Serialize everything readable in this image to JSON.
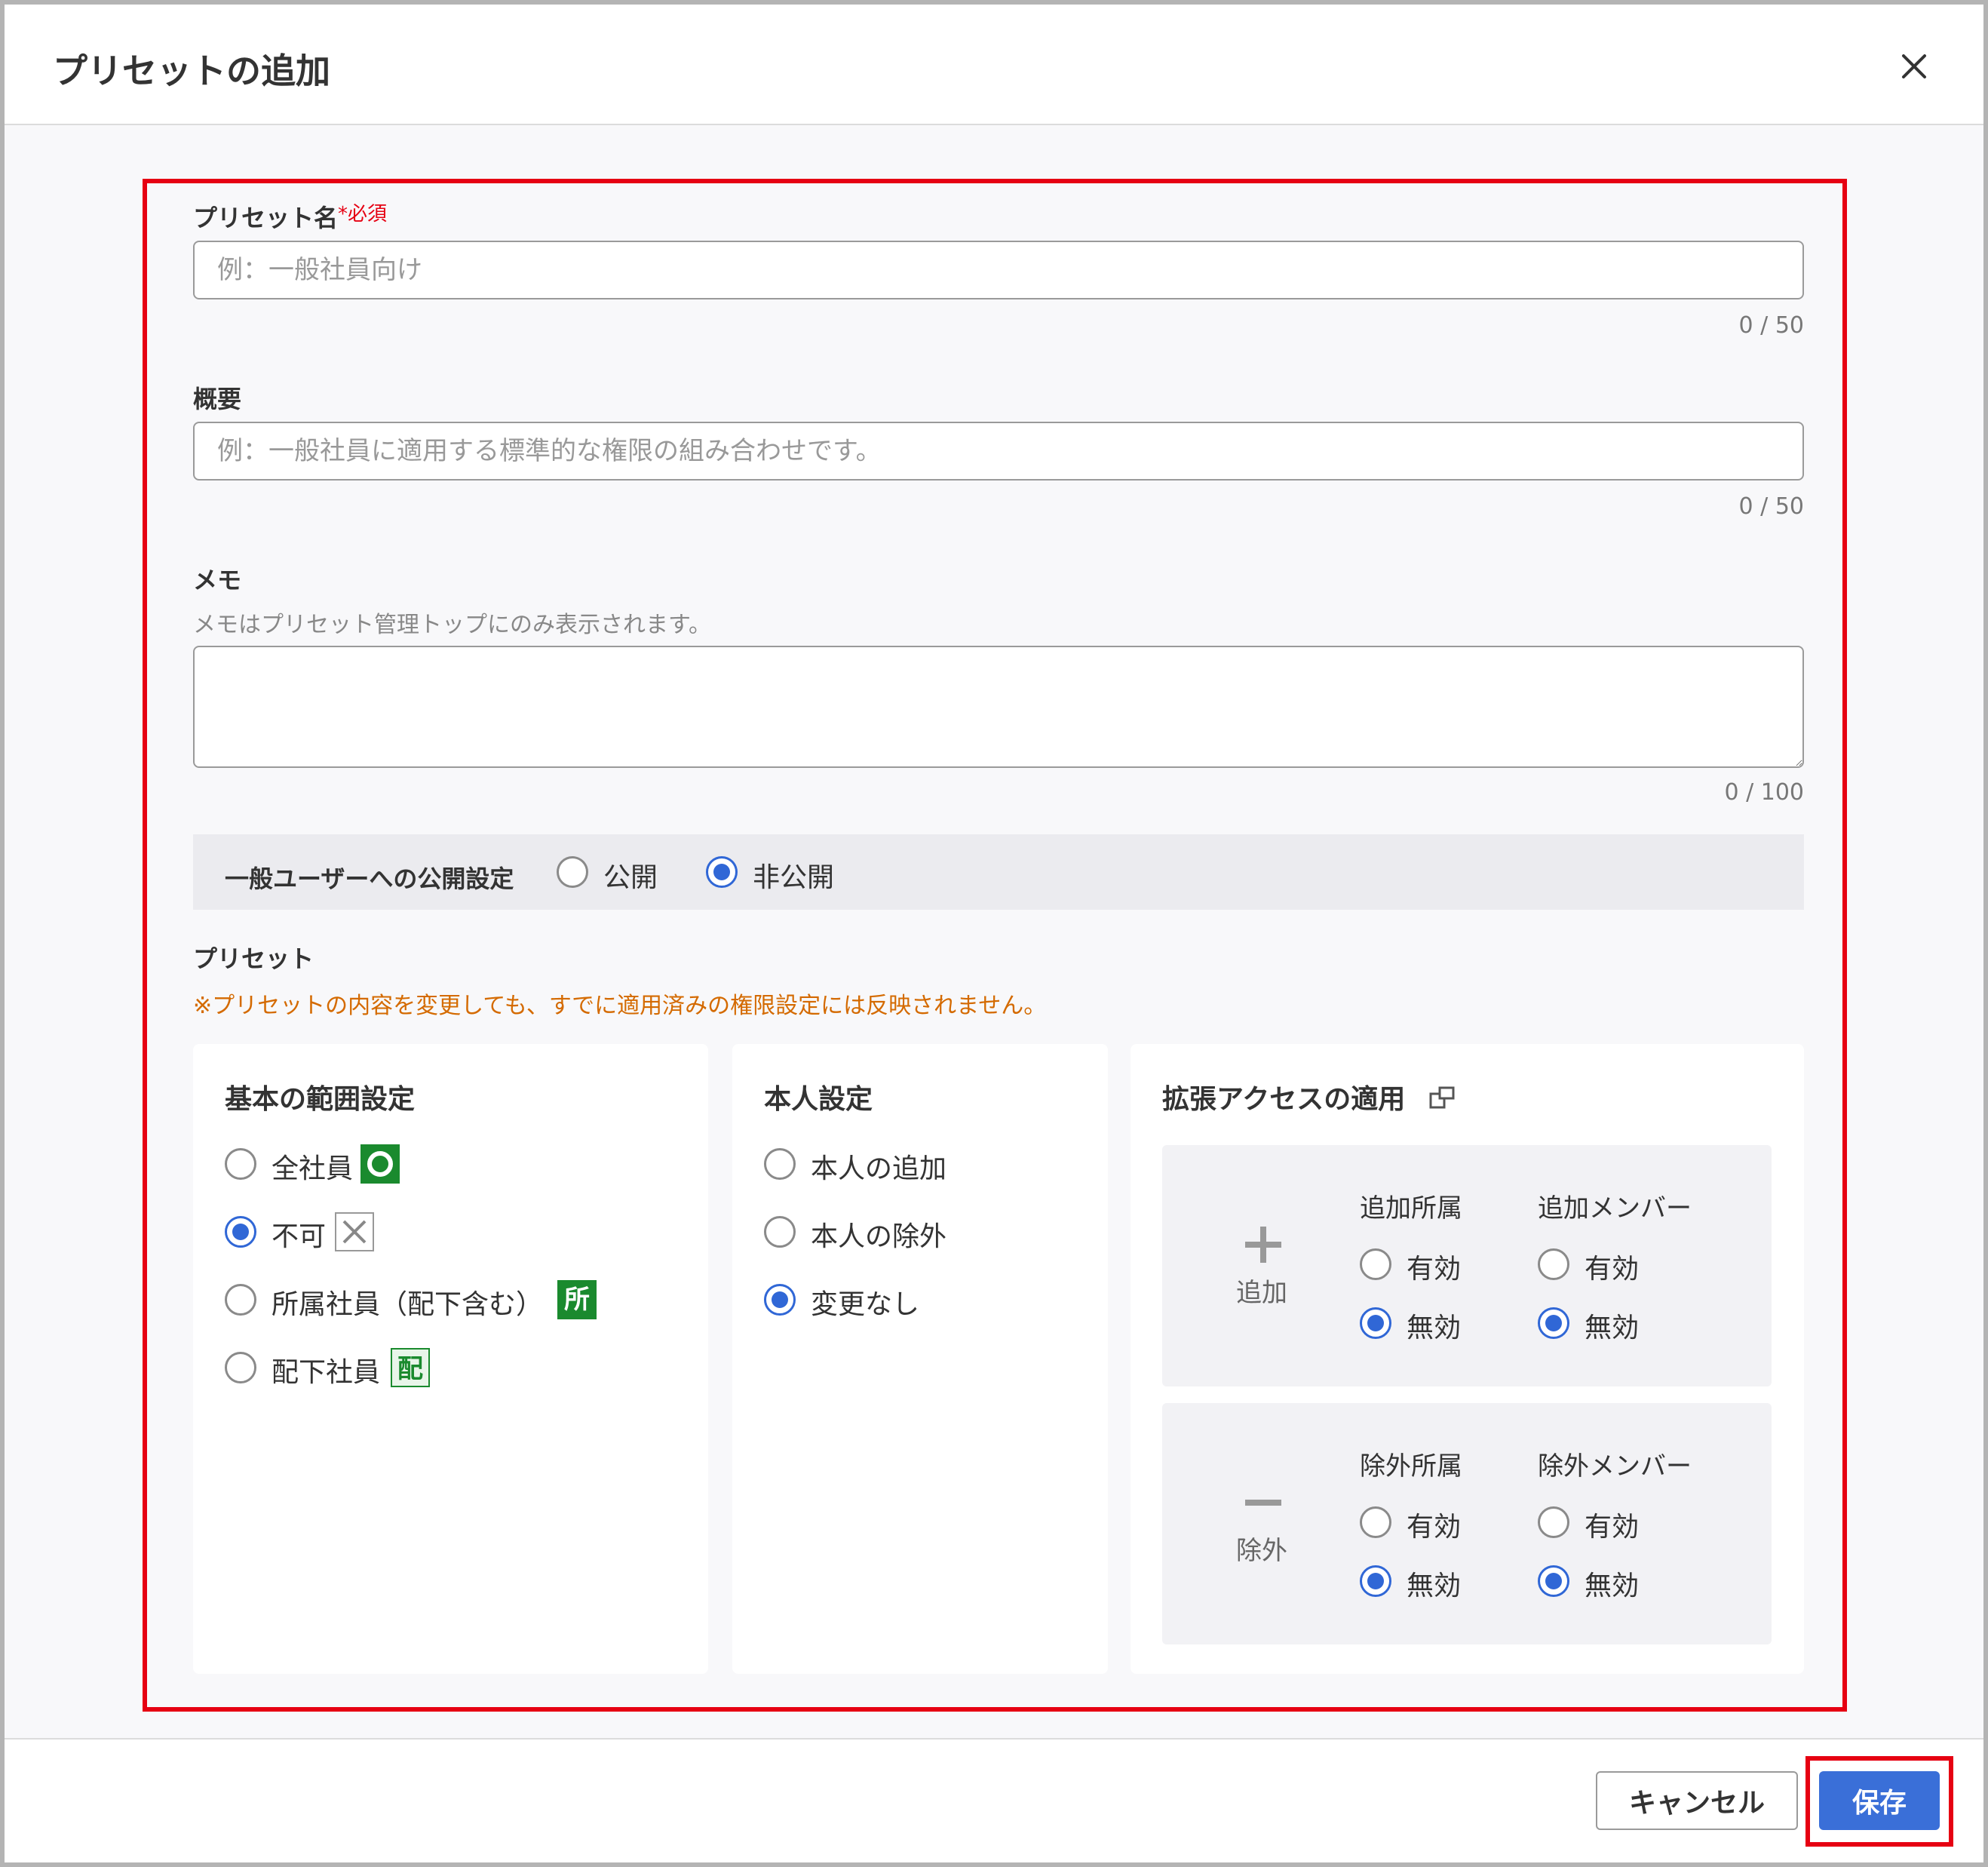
{
  "dialog": {
    "title": "プリセットの追加"
  },
  "form": {
    "preset_name": {
      "label": "プリセット名",
      "required_mark": "*必須",
      "placeholder": "例：一般社員向け",
      "value": "",
      "counter": "0 / 50"
    },
    "summary": {
      "label": "概要",
      "placeholder": "例：一般社員に適用する標準的な権限の組み合わせです。",
      "value": "",
      "counter": "0 / 50"
    },
    "memo": {
      "label": "メモ",
      "hint": "メモはプリセット管理トップにのみ表示されます。",
      "value": "",
      "counter": "0 / 100"
    },
    "publish": {
      "label": "一般ユーザーへの公開設定",
      "options": [
        "公開",
        "非公開"
      ],
      "selected": "非公開"
    },
    "preset_section": {
      "label": "プリセット",
      "warning": "※プリセットの内容を変更しても、すでに適用済みの権限設定には反映されません。"
    },
    "basic_scope": {
      "title": "基本の範囲設定",
      "options": [
        "全社員",
        "不可",
        "所属社員（配下含む）",
        "配下社員"
      ],
      "badges": [
        "O",
        "X",
        "所",
        "配"
      ],
      "selected": "不可"
    },
    "self_setting": {
      "title": "本人設定",
      "options": [
        "本人の追加",
        "本人の除外",
        "変更なし"
      ],
      "selected": "変更なし"
    },
    "extended_access": {
      "title": "拡張アクセスの適用",
      "icon": "external-link-icon",
      "add": {
        "side_label": "追加",
        "icon": "plus-icon",
        "col1": {
          "header": "追加所属",
          "options": [
            "有効",
            "無効"
          ],
          "selected": "無効"
        },
        "col2": {
          "header": "追加メンバー",
          "options": [
            "有効",
            "無効"
          ],
          "selected": "無効"
        }
      },
      "exclude": {
        "side_label": "除外",
        "icon": "minus-icon",
        "col1": {
          "header": "除外所属",
          "options": [
            "有効",
            "無効"
          ],
          "selected": "無効"
        },
        "col2": {
          "header": "除外メンバー",
          "options": [
            "有効",
            "無効"
          ],
          "selected": "無効"
        }
      }
    }
  },
  "footer": {
    "cancel_label": "キャンセル",
    "save_label": "保存"
  },
  "colors": {
    "accent": "#3a6fd8",
    "highlight": "#e60012",
    "warning": "#d46a00",
    "badge_green": "#1a8a2e"
  }
}
